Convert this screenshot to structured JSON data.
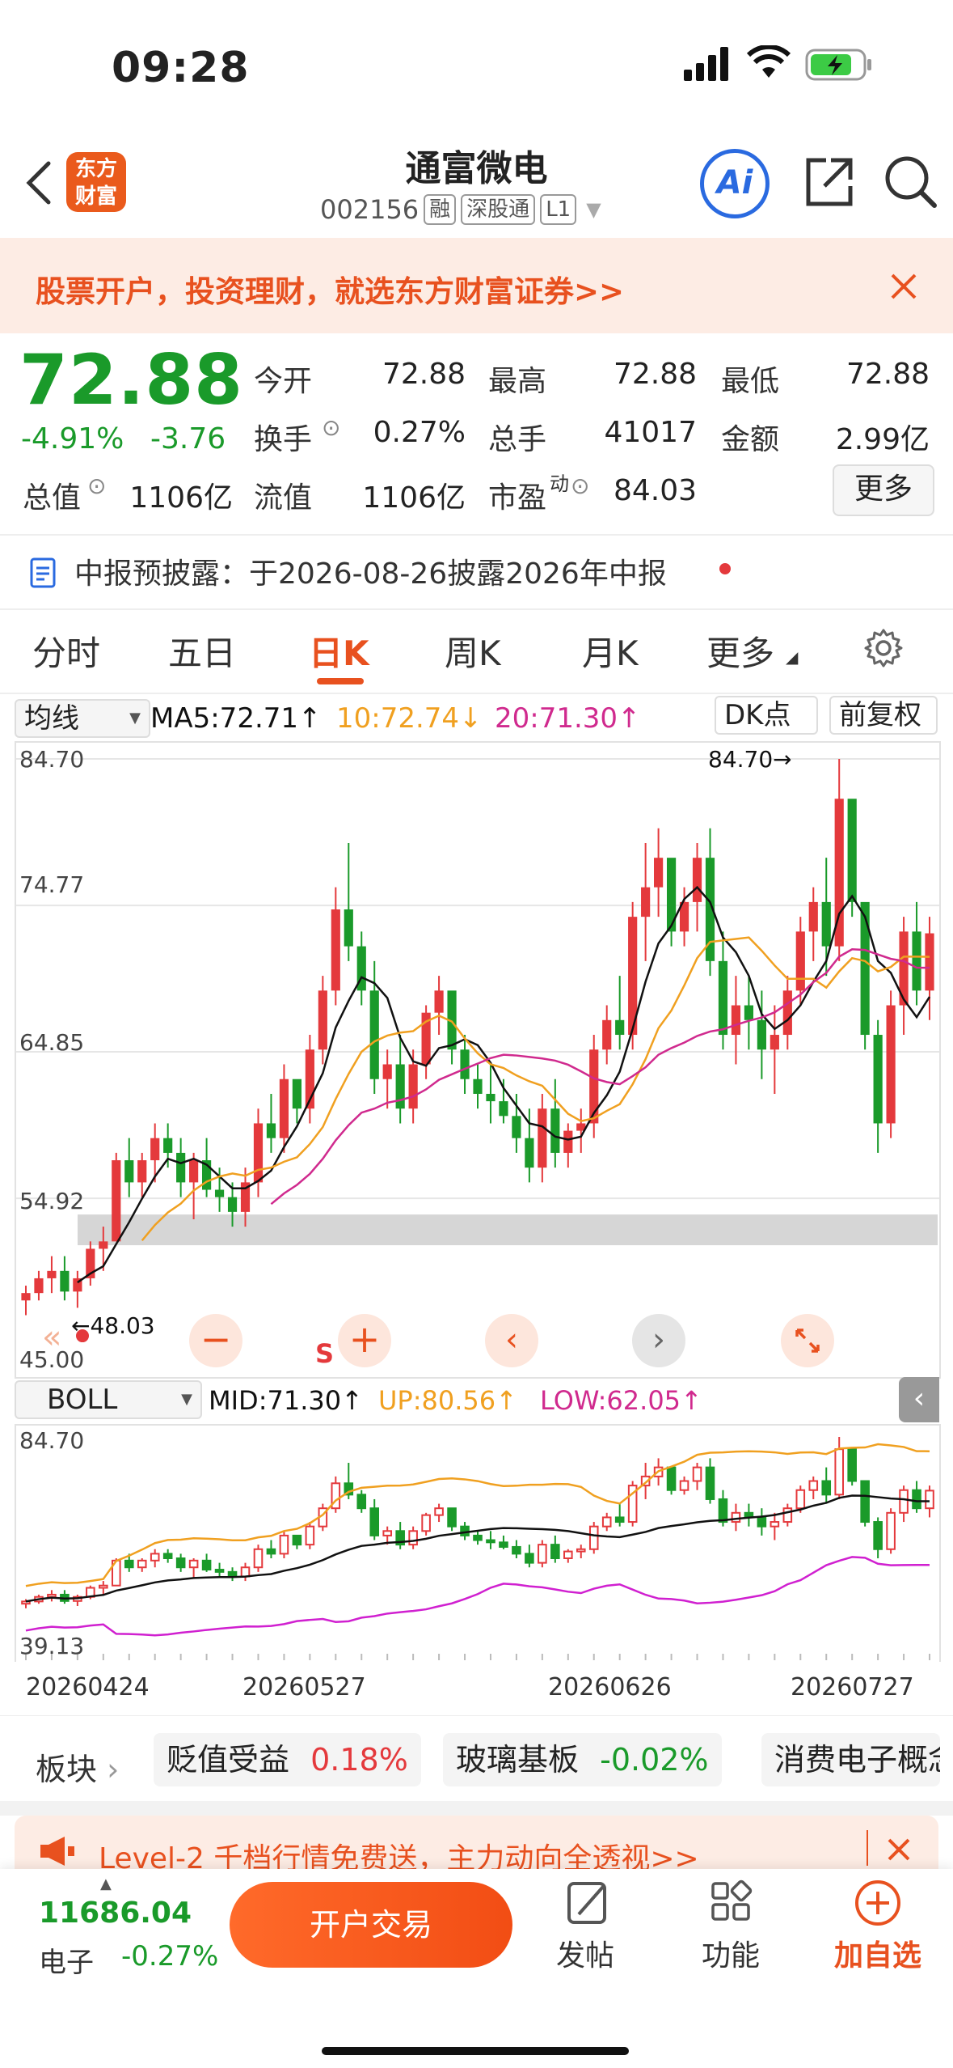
{
  "status_bar": {
    "time": "09:28"
  },
  "header": {
    "logo_text_1": "东方",
    "logo_text_2": "财富",
    "stock_name": "通富微电",
    "stock_code": "002156",
    "tags": [
      "融",
      "深股通",
      "L1"
    ],
    "ai_label": "Ai"
  },
  "banner": {
    "text": "股票开户，投资理财，就选东方财富证券>>"
  },
  "quote": {
    "price": "72.88",
    "change_pct": "-4.91%",
    "change": "-3.76",
    "open_label": "今开",
    "open": "72.88",
    "high_label": "最高",
    "high": "72.88",
    "low_label": "最低",
    "low": "72.88",
    "turnover_label": "换手",
    "turnover": "0.27%",
    "volume_label": "总手",
    "volume": "41017",
    "amount_label": "金额",
    "amount": "2.99亿",
    "mktcap_label": "总值",
    "mktcap": "1106亿",
    "float_label": "流值",
    "float_cap": "1106亿",
    "pe_label": "市盈",
    "pe_sup": "动",
    "pe": "84.03",
    "more_label": "更多"
  },
  "notice": {
    "text": "中报预披露：于2026-08-26披露2026年中报"
  },
  "tabs": [
    "分时",
    "五日",
    "日K",
    "周K",
    "月K",
    "更多"
  ],
  "kline": {
    "indicator_select": "均线",
    "ma5": "MA5:72.71↑",
    "ma10": "10:72.74↓",
    "ma20": "20:71.30↑",
    "dk_label": "DK点",
    "adjust_label": "前复权",
    "y_labels": [
      "84.70",
      "74.77",
      "64.85",
      "54.92",
      "45.00"
    ],
    "max_marker": "84.70→",
    "min_marker": "←48.03",
    "s_marker": "S"
  },
  "boll": {
    "select": "BOLL",
    "mid": "MID:71.30↑",
    "up": "UP:80.56↑",
    "low": "LOW:62.05↑",
    "y_top": "84.70",
    "y_bottom": "39.13"
  },
  "x_labels": [
    "20260424",
    "20260527",
    "20260626",
    "20260727"
  ],
  "boards": [
    {
      "label": "板块"
    },
    {
      "name": "贬值受益",
      "pct": "0.18%"
    },
    {
      "name": "玻璃基板",
      "pct": "-0.02%"
    },
    {
      "name": "消费电子概念"
    }
  ],
  "l2_banner": {
    "text": "Level-2 千档行情免费送，主力动向全透视>>"
  },
  "bottom": {
    "index_value": "11686.04",
    "index_name": "电子",
    "index_pct": "-0.27%",
    "trade_label": "开户交易",
    "post_label": "发帖",
    "func_label": "功能",
    "add_label": "加自选"
  },
  "colors": {
    "up": "#e4393c",
    "down": "#1a9a2a",
    "ma5": "#111111",
    "ma10": "#f0a020",
    "ma20": "#d02a8e",
    "accent": "#e8511f"
  },
  "chart_data": {
    "type": "candlestick",
    "y_range": [
      45.0,
      84.7
    ],
    "boll_range": [
      39.13,
      84.7
    ],
    "x_ticks": [
      "20260424",
      "20260527",
      "20260626",
      "20260727"
    ],
    "max_price": 84.7,
    "min_price": 48.03,
    "candles": [
      [
        48,
        49,
        47,
        48.5
      ],
      [
        48.5,
        50,
        48,
        49.5
      ],
      [
        49.5,
        51,
        48.5,
        50
      ],
      [
        50,
        51,
        48,
        48.6
      ],
      [
        48.6,
        50,
        47.5,
        49.5
      ],
      [
        49.5,
        52,
        49,
        51.5
      ],
      [
        51.5,
        53,
        50,
        52
      ],
      [
        52,
        58,
        52,
        57.5
      ],
      [
        57.5,
        59,
        55,
        56
      ],
      [
        56,
        58,
        55,
        57.5
      ],
      [
        57.5,
        60,
        56,
        59
      ],
      [
        59,
        60,
        57,
        58
      ],
      [
        58,
        59,
        55,
        56
      ],
      [
        56,
        58,
        53.5,
        57.5
      ],
      [
        57.5,
        59,
        55,
        55.5
      ],
      [
        55.5,
        57,
        54,
        55
      ],
      [
        55,
        56,
        53,
        54
      ],
      [
        54,
        57,
        53,
        56
      ],
      [
        56,
        61,
        55,
        60
      ],
      [
        60,
        62,
        58,
        59
      ],
      [
        59,
        64,
        58,
        63
      ],
      [
        63,
        62,
        60,
        61
      ],
      [
        61,
        66,
        60,
        65
      ],
      [
        65,
        70,
        64,
        69
      ],
      [
        69,
        76,
        68,
        74.5
      ],
      [
        74.5,
        79,
        71,
        72
      ],
      [
        72,
        73,
        68,
        69
      ],
      [
        69,
        71,
        62,
        63
      ],
      [
        63,
        65,
        61,
        64
      ],
      [
        64,
        66,
        60,
        61
      ],
      [
        61,
        65,
        60,
        64
      ],
      [
        64,
        68,
        63,
        67.5
      ],
      [
        67.5,
        70,
        66,
        69
      ],
      [
        69,
        68,
        64,
        65
      ],
      [
        65,
        66,
        62,
        63
      ],
      [
        63,
        64,
        61,
        62
      ],
      [
        62,
        64,
        60,
        61.5
      ],
      [
        61.5,
        63,
        60,
        60.5
      ],
      [
        60.5,
        62,
        58,
        59
      ],
      [
        59,
        61,
        56,
        57
      ],
      [
        57,
        62,
        56,
        61
      ],
      [
        61,
        63,
        57,
        58
      ],
      [
        58,
        60,
        57,
        59.5
      ],
      [
        59.5,
        61,
        58,
        60
      ],
      [
        60,
        66,
        59,
        65
      ],
      [
        65,
        68,
        64,
        67
      ],
      [
        67,
        70,
        65,
        66
      ],
      [
        66,
        75,
        65,
        74
      ],
      [
        74,
        79,
        71,
        76
      ],
      [
        76,
        80,
        74,
        78
      ],
      [
        78,
        76,
        72,
        73
      ],
      [
        73,
        76,
        72,
        75
      ],
      [
        75,
        79,
        73,
        78
      ],
      [
        78,
        80,
        70,
        71
      ],
      [
        71,
        73,
        65,
        66
      ],
      [
        66,
        70,
        64,
        68
      ],
      [
        68,
        70,
        65,
        67
      ],
      [
        67,
        69,
        63,
        65
      ],
      [
        65,
        68,
        62,
        66
      ],
      [
        66,
        70,
        65,
        69
      ],
      [
        69,
        74,
        68,
        73
      ],
      [
        73,
        76,
        71,
        75
      ],
      [
        75,
        78,
        70,
        72
      ],
      [
        72,
        84.7,
        71,
        82
      ],
      [
        82,
        80,
        74,
        75
      ],
      [
        75,
        73,
        65,
        66
      ],
      [
        66,
        67,
        58,
        60
      ],
      [
        60,
        69,
        59,
        68
      ],
      [
        68,
        74,
        66,
        73
      ],
      [
        73,
        75,
        68,
        69
      ],
      [
        69,
        74,
        67,
        72.88
      ]
    ]
  }
}
